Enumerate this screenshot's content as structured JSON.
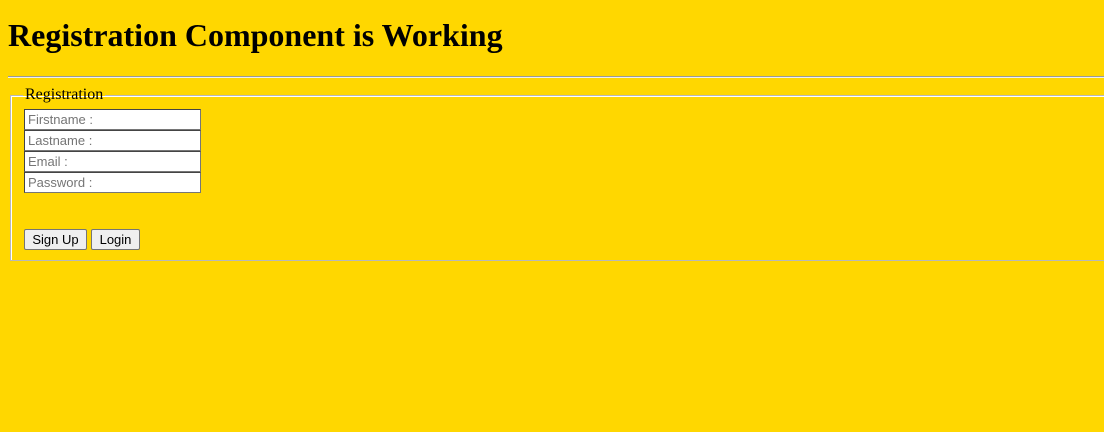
{
  "page": {
    "heading": "Registration Component is Working",
    "background_color": "#FFD700"
  },
  "form": {
    "legend": "Registration",
    "fields": [
      {
        "placeholder": "Firstname :",
        "value": ""
      },
      {
        "placeholder": "Lastname :",
        "value": ""
      },
      {
        "placeholder": "Email :",
        "value": ""
      },
      {
        "placeholder": "Password :",
        "value": ""
      }
    ],
    "buttons": {
      "signup_label": "Sign Up",
      "login_label": "Login"
    }
  }
}
